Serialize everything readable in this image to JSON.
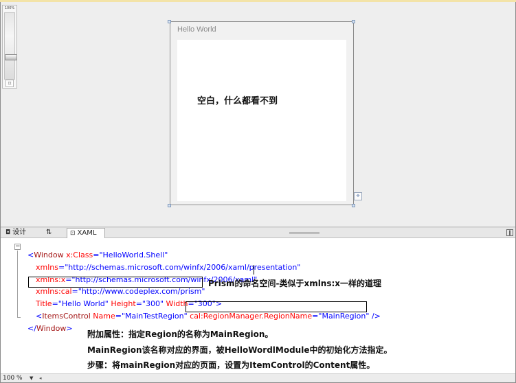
{
  "designer": {
    "zoom_slider": {
      "label": "100%",
      "level_percent": 100,
      "fit_icon": "fit-to-screen-icon"
    },
    "window_preview": {
      "title": "Hello World",
      "note": "空白，什么都看不到"
    },
    "resize_grip_icon": "crosshair-icon"
  },
  "tabs": {
    "design": {
      "label": "设计",
      "icon": "design-view-icon"
    },
    "swap": {
      "label": "⇅",
      "icon": "swap-panes-icon"
    },
    "xaml": {
      "label": "XAML",
      "icon": "xaml-view-icon",
      "active": true
    }
  },
  "code": {
    "l1": {
      "open": "<",
      "tag": "Window",
      "a1": " x:Class",
      "eq": "=",
      "v1": "\"HelloWorld.Shell\""
    },
    "l2": {
      "a": "xmlns",
      "eq": "=",
      "v": "\"http://schemas.microsoft.com/winfx/2006/xaml/presentation\""
    },
    "l3": {
      "a": "xmlns:x",
      "eq": "=",
      "v": "\"http://schemas.microsoft.com/winfx/2006/xaml\""
    },
    "l4": {
      "a": "xmlns:cal",
      "eq": "=",
      "v": "\"http://www.codeplex.com/prism\""
    },
    "l5": {
      "a1": "Title",
      "eq": "=",
      "v1": "\"Hello World\"",
      "a2": " Height",
      "v2": "\"300\"",
      "a3": " Width",
      "v3": "\"300\"",
      "close": ">"
    },
    "l6": {
      "open": "<",
      "tag": "ItemsControl",
      "a1": " Name",
      "eq": "=",
      "v1": "\"MainTestRegion\"",
      "a2": "cal:RegionManager.RegionName",
      "v2": "\"MainRegion\"",
      "close": "/>"
    },
    "l7": {
      "open": "</",
      "tag": "Window",
      "close": ">"
    }
  },
  "annotations": {
    "prism_ns": "Prism的命名空间-类似于xmlns:x一样的道理",
    "line1": "附加属性：指定Region的名称为MainRegion。",
    "line2": "MainRegion该名称对应的界面，被HelloWordlModule中的初始化方法指定。",
    "line3": "步骤：将mainRegion对应的页面，设置为ItemControl的Content属性。"
  },
  "statusbar": {
    "zoom": "100 %"
  },
  "colors": {
    "element": "#a31515",
    "attribute": "#ff0000",
    "value": "#0000ff",
    "designer_bg": "#eeeeee"
  }
}
